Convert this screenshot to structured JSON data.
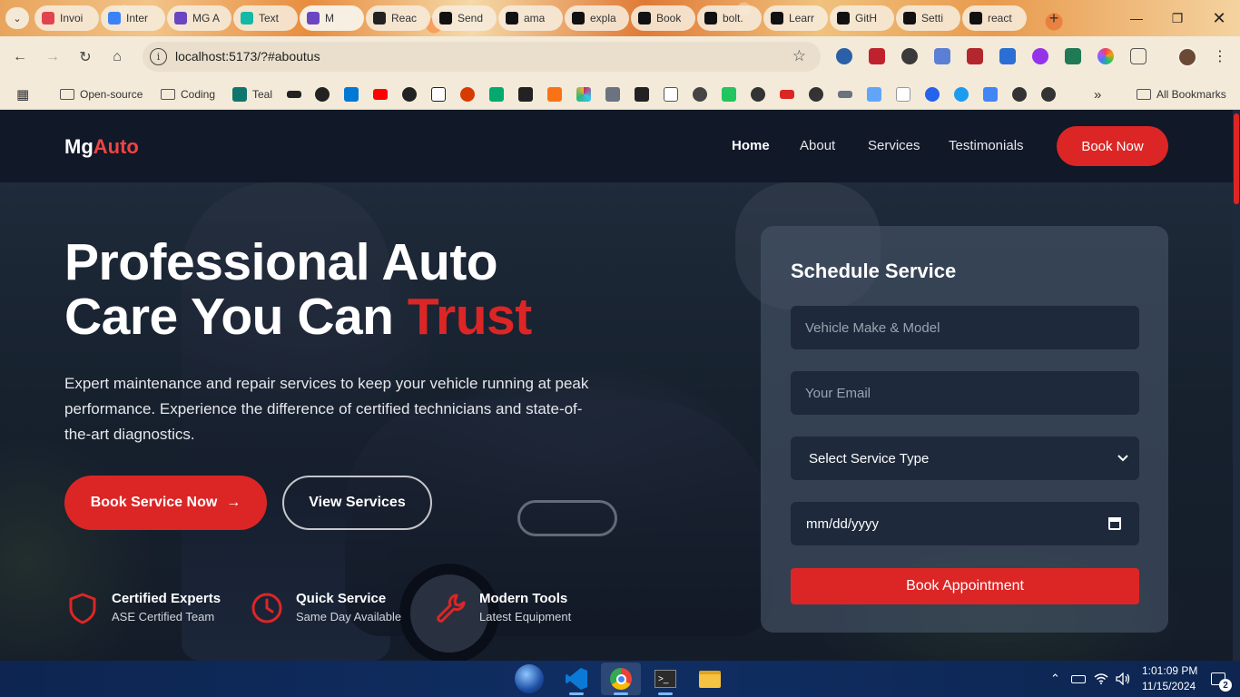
{
  "browser": {
    "tabs": [
      {
        "label": "Invoi",
        "icon": "invoice-icon",
        "color": "#e0454f"
      },
      {
        "label": "Inter",
        "icon": "globe-icon",
        "color": "#3b82f6"
      },
      {
        "label": "MG A",
        "icon": "mg-logo-icon",
        "color": "#6b46c1"
      },
      {
        "label": "Text",
        "icon": "wave-icon",
        "color": "#14b8a6"
      },
      {
        "label": "M",
        "icon": "mg-logo-icon",
        "color": "#6b46c1"
      },
      {
        "label": "Reac",
        "icon": "openai-icon",
        "color": "#222222"
      },
      {
        "label": "Send",
        "icon": "x-icon",
        "color": "#111111"
      },
      {
        "label": "ama",
        "icon": "x-icon",
        "color": "#111111"
      },
      {
        "label": "expla",
        "icon": "puzzle-icon",
        "color": "#111111"
      },
      {
        "label": "Book",
        "icon": "x-icon",
        "color": "#111111"
      },
      {
        "label": "bolt.",
        "icon": "bolt-icon",
        "color": "#111111"
      },
      {
        "label": "Learr",
        "icon": "alx-icon",
        "color": "#111111"
      },
      {
        "label": "GitH",
        "icon": "github-icon",
        "color": "#111111"
      },
      {
        "label": "Setti",
        "icon": "r-icon",
        "color": "#111111"
      },
      {
        "label": "react",
        "icon": "github-icon",
        "color": "#111111"
      }
    ],
    "url": "localhost:5173/?#aboutus",
    "bookmarks": [
      {
        "label": "Open-source",
        "type": "folder"
      },
      {
        "label": "Coding",
        "type": "folder"
      },
      {
        "label": "Teal",
        "type": "site"
      }
    ],
    "all_bookmarks": "All Bookmarks",
    "more_bookmarks": "»"
  },
  "site": {
    "logo_prefix": "Mg",
    "logo_accent": "Auto",
    "nav": [
      "Home",
      "About",
      "Services",
      "Testimonials"
    ],
    "nav_cta": "Book Now",
    "hero": {
      "title_line1": "Professional Auto",
      "title_line2_prefix": "Care You Can ",
      "title_line2_accent": "Trust",
      "description": "Expert maintenance and repair services to keep your vehicle running at peak performance. Experience the difference of certified technicians and state-of-the-art diagnostics.",
      "primary_button": "Book Service Now",
      "primary_button_arrow": "→",
      "secondary_button": "View Services"
    },
    "features": [
      {
        "title": "Certified Experts",
        "subtitle": "ASE Certified Team",
        "icon": "shield-icon"
      },
      {
        "title": "Quick Service",
        "subtitle": "Same Day Available",
        "icon": "clock-icon"
      },
      {
        "title": "Modern Tools",
        "subtitle": "Latest Equipment",
        "icon": "wrench-icon"
      }
    ],
    "form": {
      "title": "Schedule Service",
      "vehicle_placeholder": "Vehicle Make & Model",
      "email_placeholder": "Your Email",
      "service_select": "Select Service Type",
      "date_placeholder": "mm/dd/yyyy",
      "submit": "Book Appointment"
    }
  },
  "taskbar": {
    "time": "1:01:09 PM",
    "date": "11/15/2024",
    "notifications": "2"
  },
  "colors": {
    "accent": "#dc2626",
    "nav_bg": "#111827",
    "form_field_bg": "#1e293b"
  }
}
